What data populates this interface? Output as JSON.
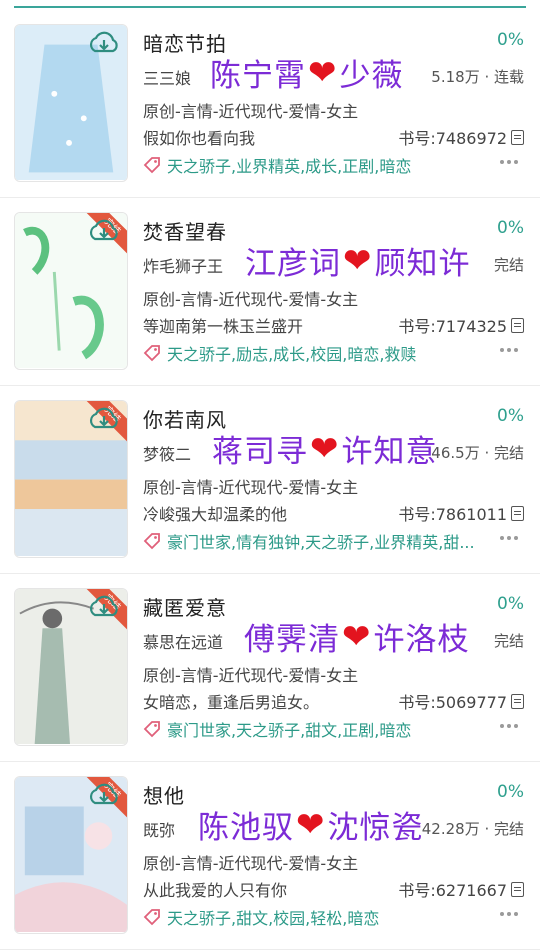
{
  "books": [
    {
      "title": "暗恋节拍",
      "percent": "0%",
      "author": "三三娘",
      "meta": "5.18万 · 连载",
      "genre": "原创-言情-近代现代-爱情-女主",
      "desc": "假如你也看向我",
      "book_no": "书号:7486972",
      "tags": "天之骄子,业界精英,成长,正剧,暗恋",
      "overlay_left": "陈宁霄",
      "overlay_right": "少薇",
      "ribbon": "",
      "cover_colors": [
        "#d9ecf7",
        "#b7dbef"
      ]
    },
    {
      "title": "焚香望春",
      "percent": "0%",
      "author": "炸毛狮子王",
      "meta": "完结",
      "genre": "原创-言情-近代现代-爱情-女主",
      "desc": "等迦南第一株玉兰盛开",
      "book_no": "书号:7174325",
      "tags": "天之骄子,励志,成长,校园,暗恋,救赎",
      "overlay_left": "江彦词",
      "overlay_right": "顾知许",
      "ribbon": "完结",
      "cover_colors": [
        "#f4faf5",
        "#d5eedc"
      ]
    },
    {
      "title": "你若南风",
      "percent": "0%",
      "author": "梦筱二",
      "meta": "46.5万 · 完结",
      "genre": "原创-言情-近代现代-爱情-女主",
      "desc": "冷峻强大却温柔的他",
      "book_no": "书号:7861011",
      "tags": "豪门世家,情有独钟,天之骄子,业界精英,甜...",
      "overlay_left": "蒋司寻",
      "overlay_right": "许知意",
      "ribbon": "完结",
      "cover_colors": [
        "#f7e3c9",
        "#c7dcea"
      ]
    },
    {
      "title": "藏匿爱意",
      "percent": "0%",
      "author": "慕思在远道",
      "meta": "完结",
      "genre": "原创-言情-近代现代-爱情-女主",
      "desc": "女暗恋，重逢后男追女。",
      "book_no": "书号:5069777",
      "tags": "豪门世家,天之骄子,甜文,正剧,暗恋",
      "overlay_left": "傅霁清",
      "overlay_right": "许洛枝",
      "ribbon": "完结",
      "cover_colors": [
        "#e8ede8",
        "#b9c9be"
      ]
    },
    {
      "title": "想他",
      "percent": "0%",
      "author": "既弥",
      "meta": "42.28万 · 完结",
      "genre": "原创-言情-近代现代-爱情-女主",
      "desc": "从此我爱的人只有你",
      "book_no": "书号:6271667",
      "tags": "天之骄子,甜文,校园,轻松,暗恋",
      "overlay_left": "陈池驭",
      "overlay_right": "沈惊瓷",
      "ribbon": "完结",
      "cover_colors": [
        "#dcebf5",
        "#f2d7dc"
      ]
    }
  ],
  "heart_symbol": "❤"
}
